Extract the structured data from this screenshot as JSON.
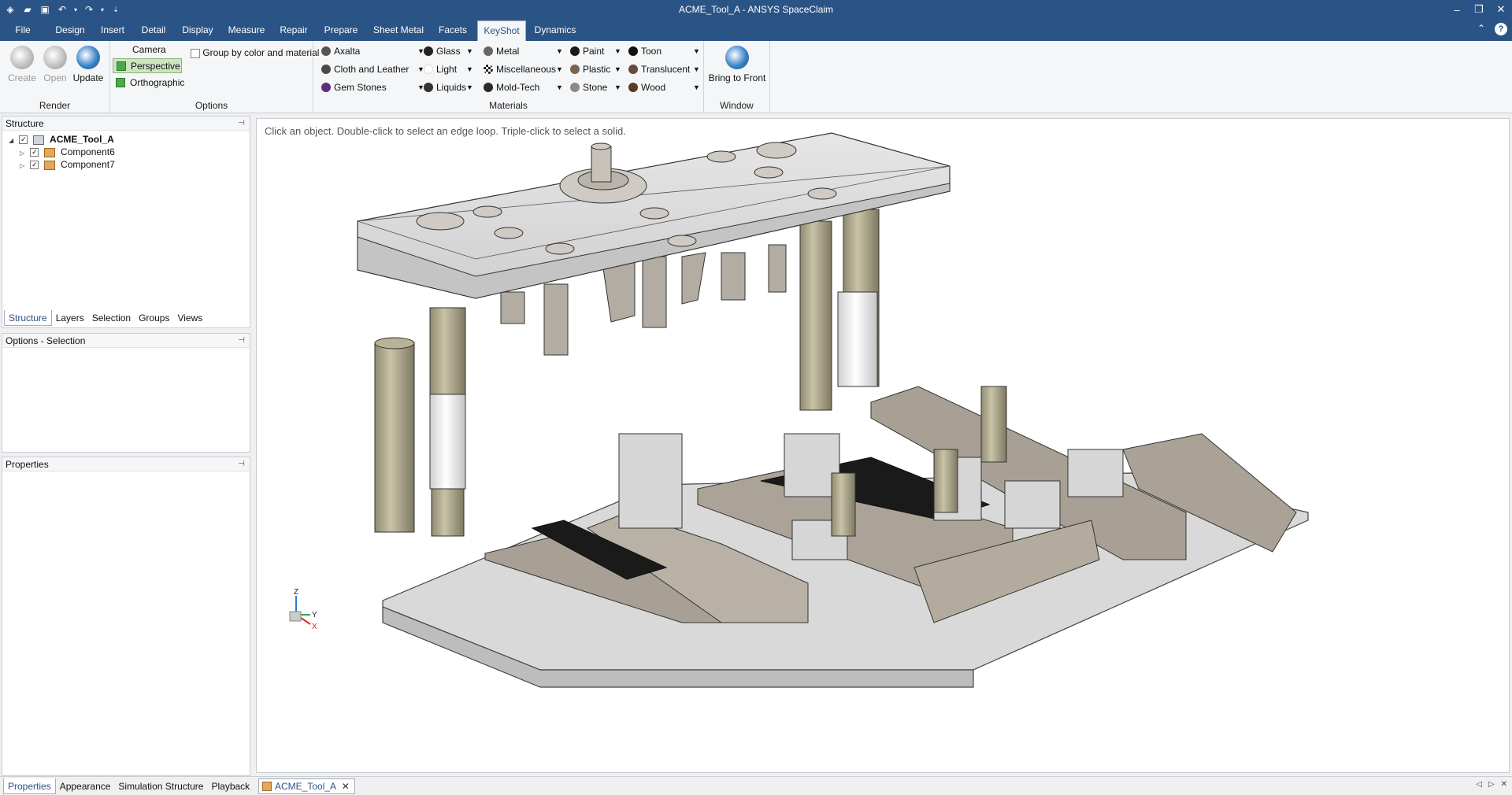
{
  "window": {
    "title": "ACME_Tool_A - ANSYS SpaceClaim"
  },
  "menu_tabs": [
    "File",
    "Design",
    "Insert",
    "Detail",
    "Display",
    "Measure",
    "Repair",
    "Prepare",
    "Sheet Metal",
    "Facets",
    "KeyShot",
    "Dynamics"
  ],
  "active_tab": "KeyShot",
  "ribbon": {
    "render": {
      "label": "Render",
      "create": "Create",
      "open": "Open",
      "update": "Update"
    },
    "options": {
      "label": "Options",
      "camera": "Camera",
      "perspective": "Perspective",
      "orthographic": "Orthographic",
      "group_by": "Group by color and material"
    },
    "materials": {
      "label": "Materials",
      "items": [
        {
          "name": "Axalta",
          "color": "#555555"
        },
        {
          "name": "Cloth and Leather",
          "color": "#4a4a4a"
        },
        {
          "name": "Gem Stones",
          "color": "#5b2f7a"
        },
        {
          "name": "Glass",
          "color": "#222222"
        },
        {
          "name": "Light",
          "color": "#ffffff"
        },
        {
          "name": "Liquids",
          "color": "#333333"
        },
        {
          "name": "Metal",
          "color": "#666666"
        },
        {
          "name": "Miscellaneous",
          "color": "#444444"
        },
        {
          "name": "Mold-Tech",
          "color": "#2a2a2a"
        },
        {
          "name": "Paint",
          "color": "#1a1a1a"
        },
        {
          "name": "Plastic",
          "color": "#7a6550"
        },
        {
          "name": "Stone",
          "color": "#8a8a8a"
        },
        {
          "name": "Toon",
          "color": "#111111"
        },
        {
          "name": "Translucent",
          "color": "#6a4a3a"
        },
        {
          "name": "Wood",
          "color": "#5a3a22"
        }
      ]
    },
    "window": {
      "label": "Window",
      "bring_to_front": "Bring to Front"
    }
  },
  "structure_panel": {
    "title": "Structure",
    "root": "ACME_Tool_A",
    "children": [
      "Component6",
      "Component7"
    ],
    "tabs": [
      "Structure",
      "Layers",
      "Selection",
      "Groups",
      "Views"
    ]
  },
  "options_panel": {
    "title": "Options - Selection"
  },
  "properties_panel": {
    "title": "Properties",
    "tabs": [
      "Properties",
      "Appearance",
      "Simulation Structure",
      "Playback"
    ]
  },
  "viewport": {
    "hint": "Click an object. Double-click to select an edge loop. Triple-click to select a solid.",
    "axes": {
      "z": "Z",
      "y": "Y",
      "x": "X"
    }
  },
  "document_tab": "ACME_Tool_A"
}
